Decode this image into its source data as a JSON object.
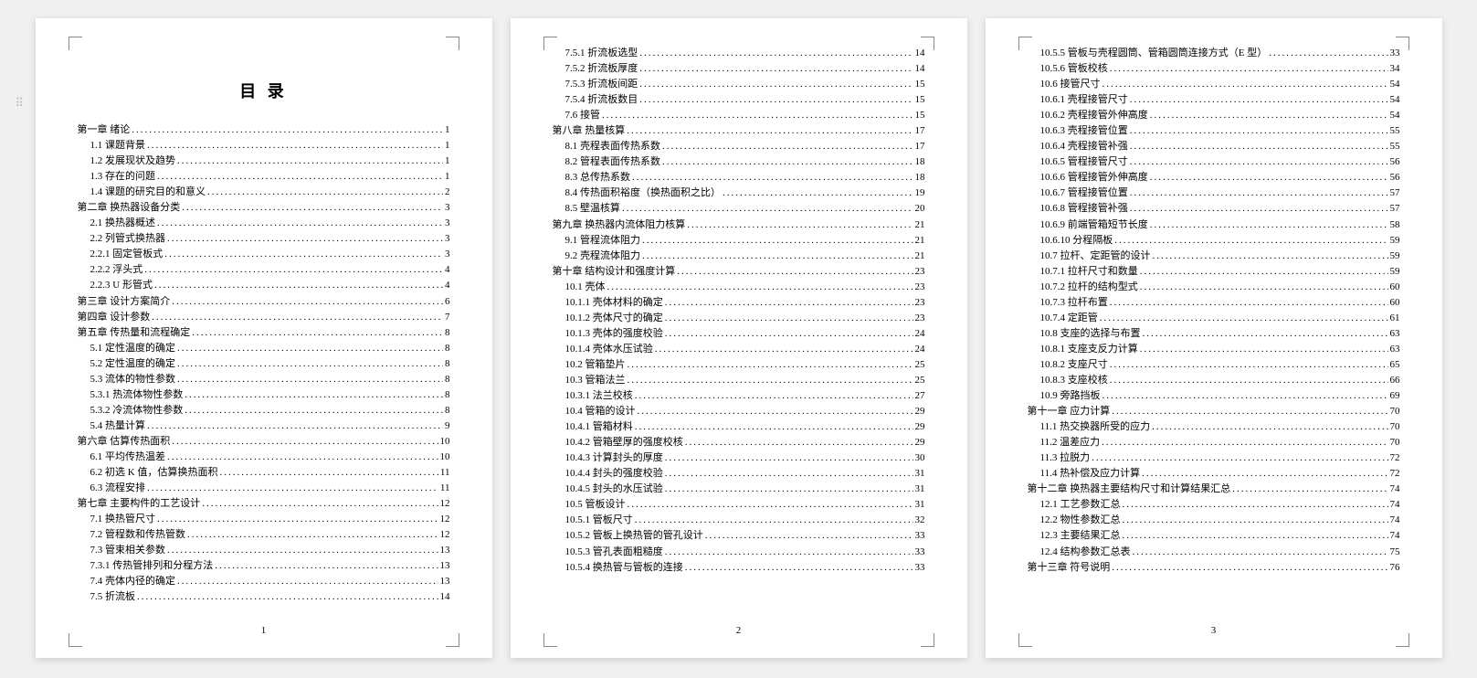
{
  "toc_title": "目 录",
  "pages": [
    {
      "number": "1",
      "entries": [
        {
          "level": 0,
          "label": "第一章  绪论",
          "page": "1"
        },
        {
          "level": 1,
          "label": "1.1 课题背景",
          "page": "1"
        },
        {
          "level": 1,
          "label": "1.2 发展现状及趋势",
          "page": "1"
        },
        {
          "level": 1,
          "label": "1.3 存在的问题",
          "page": "1"
        },
        {
          "level": 1,
          "label": "1.4 课题的研究目的和意义",
          "page": "2"
        },
        {
          "level": 0,
          "label": "第二章  换热器设备分类",
          "page": "3"
        },
        {
          "level": 1,
          "label": "2.1 换热器概述",
          "page": "3"
        },
        {
          "level": 1,
          "label": "2.2 列管式换热器",
          "page": "3"
        },
        {
          "level": 1,
          "label": "2.2.1 固定管板式",
          "page": "3"
        },
        {
          "level": 1,
          "label": "2.2.2 浮头式",
          "page": "4"
        },
        {
          "level": 1,
          "label": "2.2.3 U 形管式",
          "page": "4"
        },
        {
          "level": 0,
          "label": "第三章  设计方案简介",
          "page": "6"
        },
        {
          "level": 0,
          "label": "第四章  设计参数",
          "page": "7"
        },
        {
          "level": 0,
          "label": "第五章  传热量和流程确定",
          "page": "8"
        },
        {
          "level": 1,
          "label": "5.1 定性温度的确定",
          "page": "8"
        },
        {
          "level": 1,
          "label": "5.2 定性温度的确定",
          "page": "8"
        },
        {
          "level": 1,
          "label": "5.3 流体的物性参数",
          "page": "8"
        },
        {
          "level": 1,
          "label": "5.3.1 热流体物性参数",
          "page": "8"
        },
        {
          "level": 1,
          "label": "5.3.2 冷流体物性参数",
          "page": "8"
        },
        {
          "level": 1,
          "label": "5.4 热量计算",
          "page": "9"
        },
        {
          "level": 0,
          "label": "第六章  估算传热面积",
          "page": "10"
        },
        {
          "level": 1,
          "label": "6.1 平均传热温差",
          "page": "10"
        },
        {
          "level": 1,
          "label": "6.2 初选 K 值，估算换热面积",
          "page": "11"
        },
        {
          "level": 1,
          "label": "6.3 流程安排",
          "page": "11"
        },
        {
          "level": 0,
          "label": "第七章  主要构件的工艺设计",
          "page": "12"
        },
        {
          "level": 1,
          "label": "7.1 换热管尺寸",
          "page": "12"
        },
        {
          "level": 1,
          "label": "7.2 管程数和传热管数",
          "page": "12"
        },
        {
          "level": 1,
          "label": "7.3 管束相关参数",
          "page": "13"
        },
        {
          "level": 1,
          "label": "7.3.1 传热管排列和分程方法",
          "page": "13"
        },
        {
          "level": 1,
          "label": "7.4 壳体内径的确定",
          "page": "13"
        },
        {
          "level": 1,
          "label": "7.5 折流板",
          "page": "14"
        }
      ]
    },
    {
      "number": "2",
      "entries": [
        {
          "level": 2,
          "label": "7.5.1 折流板选型",
          "page": "14"
        },
        {
          "level": 2,
          "label": "7.5.2 折流板厚度",
          "page": "14"
        },
        {
          "level": 2,
          "label": "7.5.3 折流板间距",
          "page": "15"
        },
        {
          "level": 2,
          "label": "7.5.4 折流板数目",
          "page": "15"
        },
        {
          "level": 1,
          "label": "7.6 接管",
          "page": "15"
        },
        {
          "level": 0,
          "label": "第八章  热量核算",
          "page": "17"
        },
        {
          "level": 1,
          "label": "8.1 壳程表面传热系数",
          "page": "17"
        },
        {
          "level": 1,
          "label": "8.2 管程表面传热系数",
          "page": "18"
        },
        {
          "level": 1,
          "label": "8.3 总传热系数",
          "page": "18"
        },
        {
          "level": 1,
          "label": "8.4 传热面积裕度（换热面积之比）",
          "page": "19"
        },
        {
          "level": 1,
          "label": "8.5 壁温核算",
          "page": "20"
        },
        {
          "level": 0,
          "label": "第九章  换热器内流体阻力核算",
          "page": "21"
        },
        {
          "level": 1,
          "label": "9.1 管程流体阻力",
          "page": "21"
        },
        {
          "level": 1,
          "label": "9.2 壳程流体阻力",
          "page": "21"
        },
        {
          "level": 0,
          "label": "第十章  结构设计和强度计算",
          "page": "23"
        },
        {
          "level": 1,
          "label": "10.1 壳体",
          "page": "23"
        },
        {
          "level": 2,
          "label": "10.1.1 壳体材料的确定",
          "page": "23"
        },
        {
          "level": 2,
          "label": "10.1.2 壳体尺寸的确定",
          "page": "23"
        },
        {
          "level": 2,
          "label": "10.1.3 壳体的强度校验",
          "page": "24"
        },
        {
          "level": 2,
          "label": "10.1.4 壳体水压试验",
          "page": "24"
        },
        {
          "level": 1,
          "label": "10.2 管箱垫片",
          "page": "25"
        },
        {
          "level": 1,
          "label": "10.3 管箱法兰",
          "page": "25"
        },
        {
          "level": 2,
          "label": "10.3.1 法兰校核",
          "page": "27"
        },
        {
          "level": 1,
          "label": "10.4 管箱的设计",
          "page": "29"
        },
        {
          "level": 2,
          "label": "10.4.1 管箱材料",
          "page": "29"
        },
        {
          "level": 2,
          "label": "10.4.2 管箱壁厚的强度校核",
          "page": "29"
        },
        {
          "level": 2,
          "label": "10.4.3 计算封头的厚度",
          "page": "30"
        },
        {
          "level": 2,
          "label": "10.4.4 封头的强度校验",
          "page": "31"
        },
        {
          "level": 2,
          "label": "10.4.5 封头的水压试验",
          "page": "31"
        },
        {
          "level": 1,
          "label": "10.5 管板设计",
          "page": "31"
        },
        {
          "level": 2,
          "label": "10.5.1 管板尺寸",
          "page": "32"
        },
        {
          "level": 2,
          "label": "10.5.2 管板上换热管的管孔设计",
          "page": "33"
        },
        {
          "level": 2,
          "label": "10.5.3 管孔表面粗糙度",
          "page": "33"
        },
        {
          "level": 2,
          "label": "10.5.4 换热管与管板的连接",
          "page": "33"
        }
      ]
    },
    {
      "number": "3",
      "entries": [
        {
          "level": 2,
          "label": "10.5.5 管板与壳程圆筒、管箱圆筒连接方式（E 型）",
          "page": "33"
        },
        {
          "level": 2,
          "label": "10.5.6 管板校核",
          "page": "34"
        },
        {
          "level": 1,
          "label": "10.6 接管尺寸",
          "page": "54"
        },
        {
          "level": 2,
          "label": "10.6.1 壳程接管尺寸",
          "page": "54"
        },
        {
          "level": 2,
          "label": "10.6.2 壳程接管外伸高度",
          "page": "54"
        },
        {
          "level": 2,
          "label": "10.6.3 壳程接管位置",
          "page": "55"
        },
        {
          "level": 2,
          "label": "10.6.4 壳程接管补强",
          "page": "55"
        },
        {
          "level": 2,
          "label": "10.6.5 管程接管尺寸",
          "page": "56"
        },
        {
          "level": 2,
          "label": "10.6.6 管程接管外伸高度",
          "page": "56"
        },
        {
          "level": 2,
          "label": "10.6.7 管程接管位置",
          "page": "57"
        },
        {
          "level": 2,
          "label": "10.6.8 管程接管补强",
          "page": "57"
        },
        {
          "level": 2,
          "label": "10.6.9 前端管箱短节长度",
          "page": "58"
        },
        {
          "level": 2,
          "label": "10.6.10 分程隔板",
          "page": "59"
        },
        {
          "level": 1,
          "label": "10.7 拉杆、定距管的设计",
          "page": "59"
        },
        {
          "level": 2,
          "label": "10.7.1 拉杆尺寸和数量",
          "page": "59"
        },
        {
          "level": 2,
          "label": "10.7.2 拉杆的结构型式",
          "page": "60"
        },
        {
          "level": 2,
          "label": "10.7.3 拉杆布置",
          "page": "60"
        },
        {
          "level": 2,
          "label": "10.7.4 定距管",
          "page": "61"
        },
        {
          "level": 1,
          "label": "10.8 支座的选择与布置",
          "page": "63"
        },
        {
          "level": 2,
          "label": "10.8.1 支座支反力计算",
          "page": "63"
        },
        {
          "level": 2,
          "label": "10.8.2 支座尺寸",
          "page": "65"
        },
        {
          "level": 2,
          "label": "10.8.3 支座校核",
          "page": "66"
        },
        {
          "level": 1,
          "label": "10.9 旁路挡板",
          "page": "69"
        },
        {
          "level": 0,
          "label": "第十一章  应力计算",
          "page": "70"
        },
        {
          "level": 1,
          "label": "11.1 热交换器所受的应力",
          "page": "70"
        },
        {
          "level": 1,
          "label": "11.2 温差应力",
          "page": "70"
        },
        {
          "level": 1,
          "label": "11.3 拉脱力",
          "page": "72"
        },
        {
          "level": 1,
          "label": "11.4 热补偿及应力计算",
          "page": "72"
        },
        {
          "level": 0,
          "label": "第十二章  换热器主要结构尺寸和计算结果汇总",
          "page": "74"
        },
        {
          "level": 1,
          "label": "12.1 工艺参数汇总",
          "page": "74"
        },
        {
          "level": 1,
          "label": "12.2 物性参数汇总",
          "page": "74"
        },
        {
          "level": 1,
          "label": "12.3 主要结果汇总",
          "page": "74"
        },
        {
          "level": 1,
          "label": "12.4 结构参数汇总表",
          "page": "75"
        },
        {
          "level": 0,
          "label": "第十三章  符号说明",
          "page": "76"
        }
      ]
    }
  ]
}
